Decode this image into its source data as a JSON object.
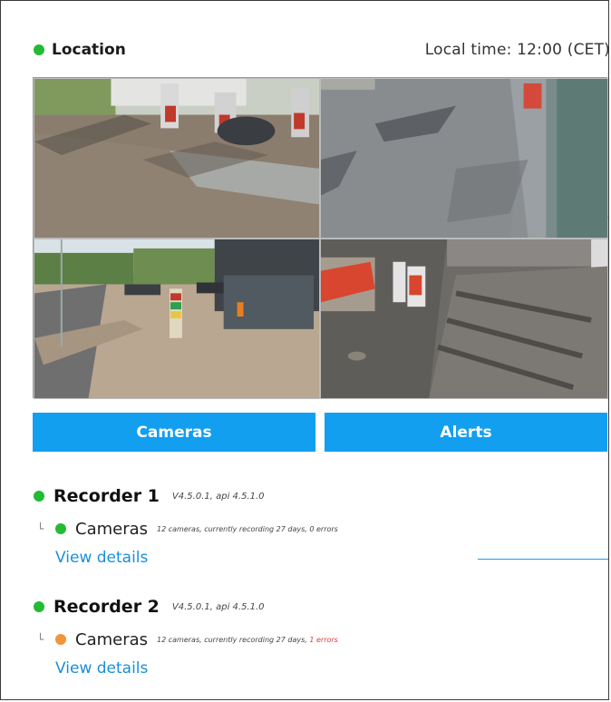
{
  "header": {
    "location_label": "Location",
    "local_time": "Local time: 12:00 (CET)"
  },
  "cameras": [
    {
      "name": "camera-feed-1"
    },
    {
      "name": "camera-feed-2"
    },
    {
      "name": "camera-feed-3"
    },
    {
      "name": "camera-feed-4"
    }
  ],
  "buttons": {
    "cameras": "Cameras",
    "alerts": "Alerts"
  },
  "recorders": [
    {
      "name": "Recorder 1",
      "version": "V4.5.0.1, api 4.5.1.0",
      "status_color": "#22bb33",
      "sub_label": "Cameras",
      "sub_desc": "12 cameras, currently recording 27 days, 0 errors",
      "sub_desc_error": "",
      "sub_status_color": "#22bb33",
      "details": "View details"
    },
    {
      "name": "Recorder 2",
      "version": "V4.5.0.1, api 4.5.1.0",
      "status_color": "#22bb33",
      "sub_label": "Cameras",
      "sub_desc": "12 cameras, currently recording 27 days, ",
      "sub_desc_error": "1 errors",
      "sub_status_color": "#f0953a",
      "details": "View details"
    }
  ],
  "colors": {
    "accent": "#129ff0",
    "ok": "#22bb33",
    "warning": "#f0953a",
    "error": "#e23a3a"
  }
}
